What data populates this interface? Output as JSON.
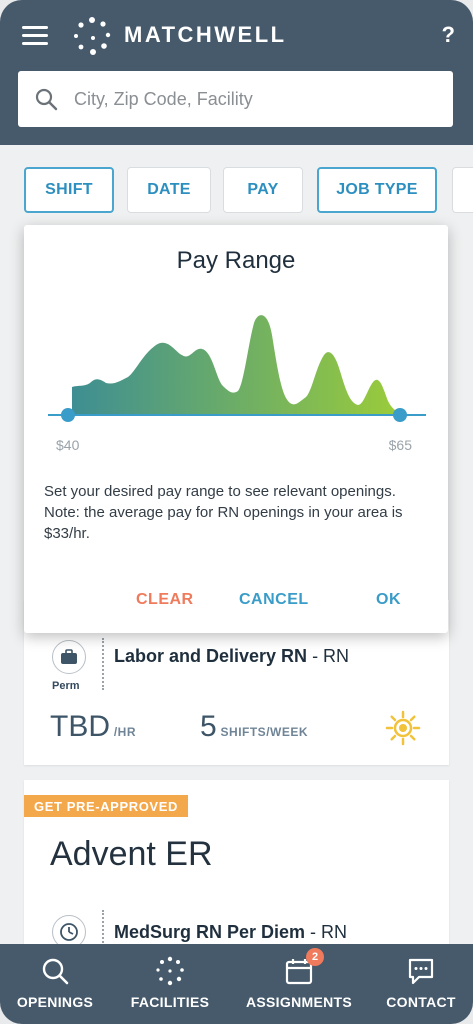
{
  "app": {
    "brand": "MATCHWELL",
    "help_label": "?"
  },
  "search": {
    "placeholder": "City, Zip Code, Facility",
    "value": ""
  },
  "filters": [
    {
      "label": "SHIFT"
    },
    {
      "label": "DATE"
    },
    {
      "label": "PAY"
    },
    {
      "label": "JOB TYPE"
    },
    {
      "label": ""
    }
  ],
  "modal": {
    "title": "Pay Range",
    "min_label": "$40",
    "max_label": "$65",
    "range_min": 40,
    "range_max": 65,
    "description": "Set your desired pay range to see relevant openings. Note: the average pay for RN openings in your area is $33/hr.",
    "clear_label": "CLEAR",
    "cancel_label": "CANCEL",
    "ok_label": "OK",
    "colors": {
      "start": "#3e8e93",
      "end": "#9bcc3a",
      "track": "#3a9cc8"
    }
  },
  "listings": [
    {
      "type": "Perm",
      "job_title": "Labor and Delivery RN",
      "discipline": " - RN",
      "pay": "TBD",
      "pay_unit": " /HR",
      "shifts": "5",
      "shifts_unit": " SHIFTS/WEEK",
      "shift_icon": "sun-icon"
    },
    {
      "badge": "GET PRE-APPROVED",
      "facility": "Advent ER",
      "job_title": "MedSurg RN Per Diem",
      "discipline": " - RN",
      "type_icon": "clock-icon"
    }
  ],
  "nav": {
    "openings": "OPENINGS",
    "facilities": "FACILITIES",
    "assignments": "ASSIGNMENTS",
    "assignments_badge": "2",
    "contact": "CONTACT"
  },
  "theme": {
    "header": "#465a6c",
    "accent": "#3a9cc8",
    "badge": "#f4a84c",
    "danger": "#ef7a5c"
  }
}
